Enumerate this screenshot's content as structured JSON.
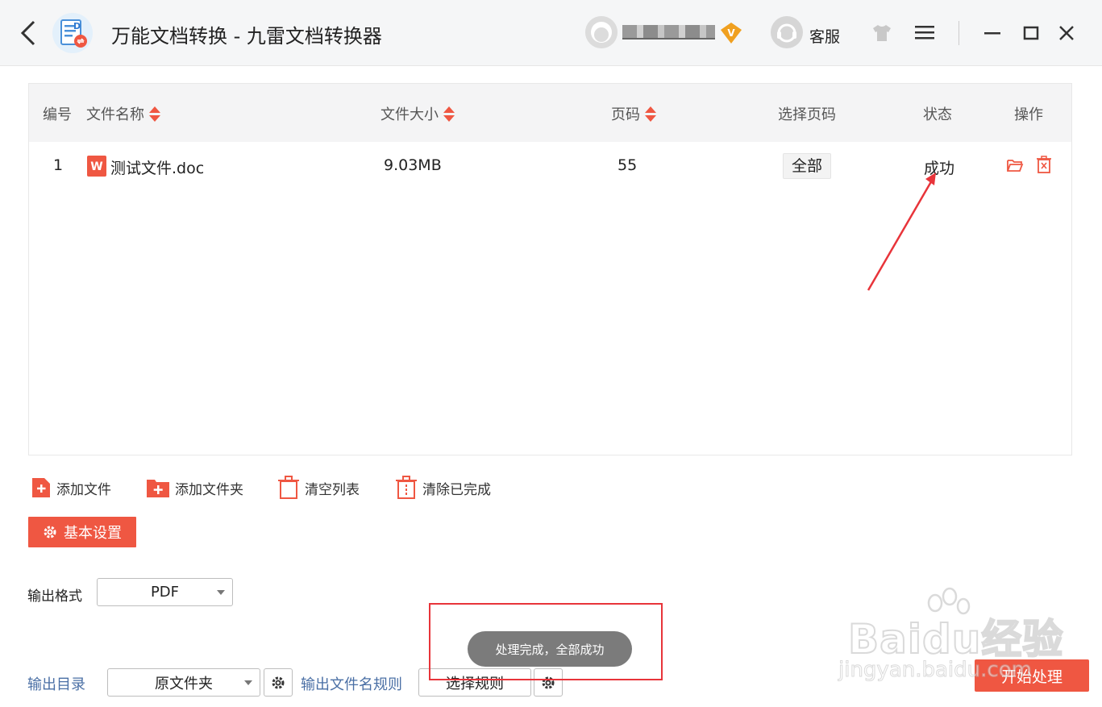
{
  "titlebar": {
    "title": "万能文档转换 - 九雷文档转换器",
    "service_label": "客服",
    "vip_badge": "V"
  },
  "table": {
    "headers": {
      "index": "编号",
      "name": "文件名称",
      "size": "文件大小",
      "pages": "页码",
      "page_select": "选择页码",
      "status": "状态",
      "actions": "操作"
    },
    "rows": [
      {
        "index": "1",
        "name": "测试文件.doc",
        "size": "9.03MB",
        "pages": "55",
        "page_select": "全部",
        "status": "成功"
      }
    ]
  },
  "toolbar": {
    "add_file": "添加文件",
    "add_folder": "添加文件夹",
    "clear_list": "清空列表",
    "clear_done": "清除已完成"
  },
  "settings": {
    "basic_settings": "基本设置",
    "output_format_label": "输出格式",
    "output_format_value": "PDF",
    "output_dir_label": "输出目录",
    "output_dir_value": "原文件夹",
    "filename_rule_label": "输出文件名规则",
    "filename_rule_value": "选择规则"
  },
  "toast": "处理完成，全部成功",
  "start_button": "开始处理",
  "watermark": {
    "brand": "Baidu经验",
    "url": "jingyan.baidu.com"
  },
  "colors": {
    "accent": "#ef5742",
    "annotation": "#e8343a",
    "toast_bg": "#7b7b7b"
  }
}
